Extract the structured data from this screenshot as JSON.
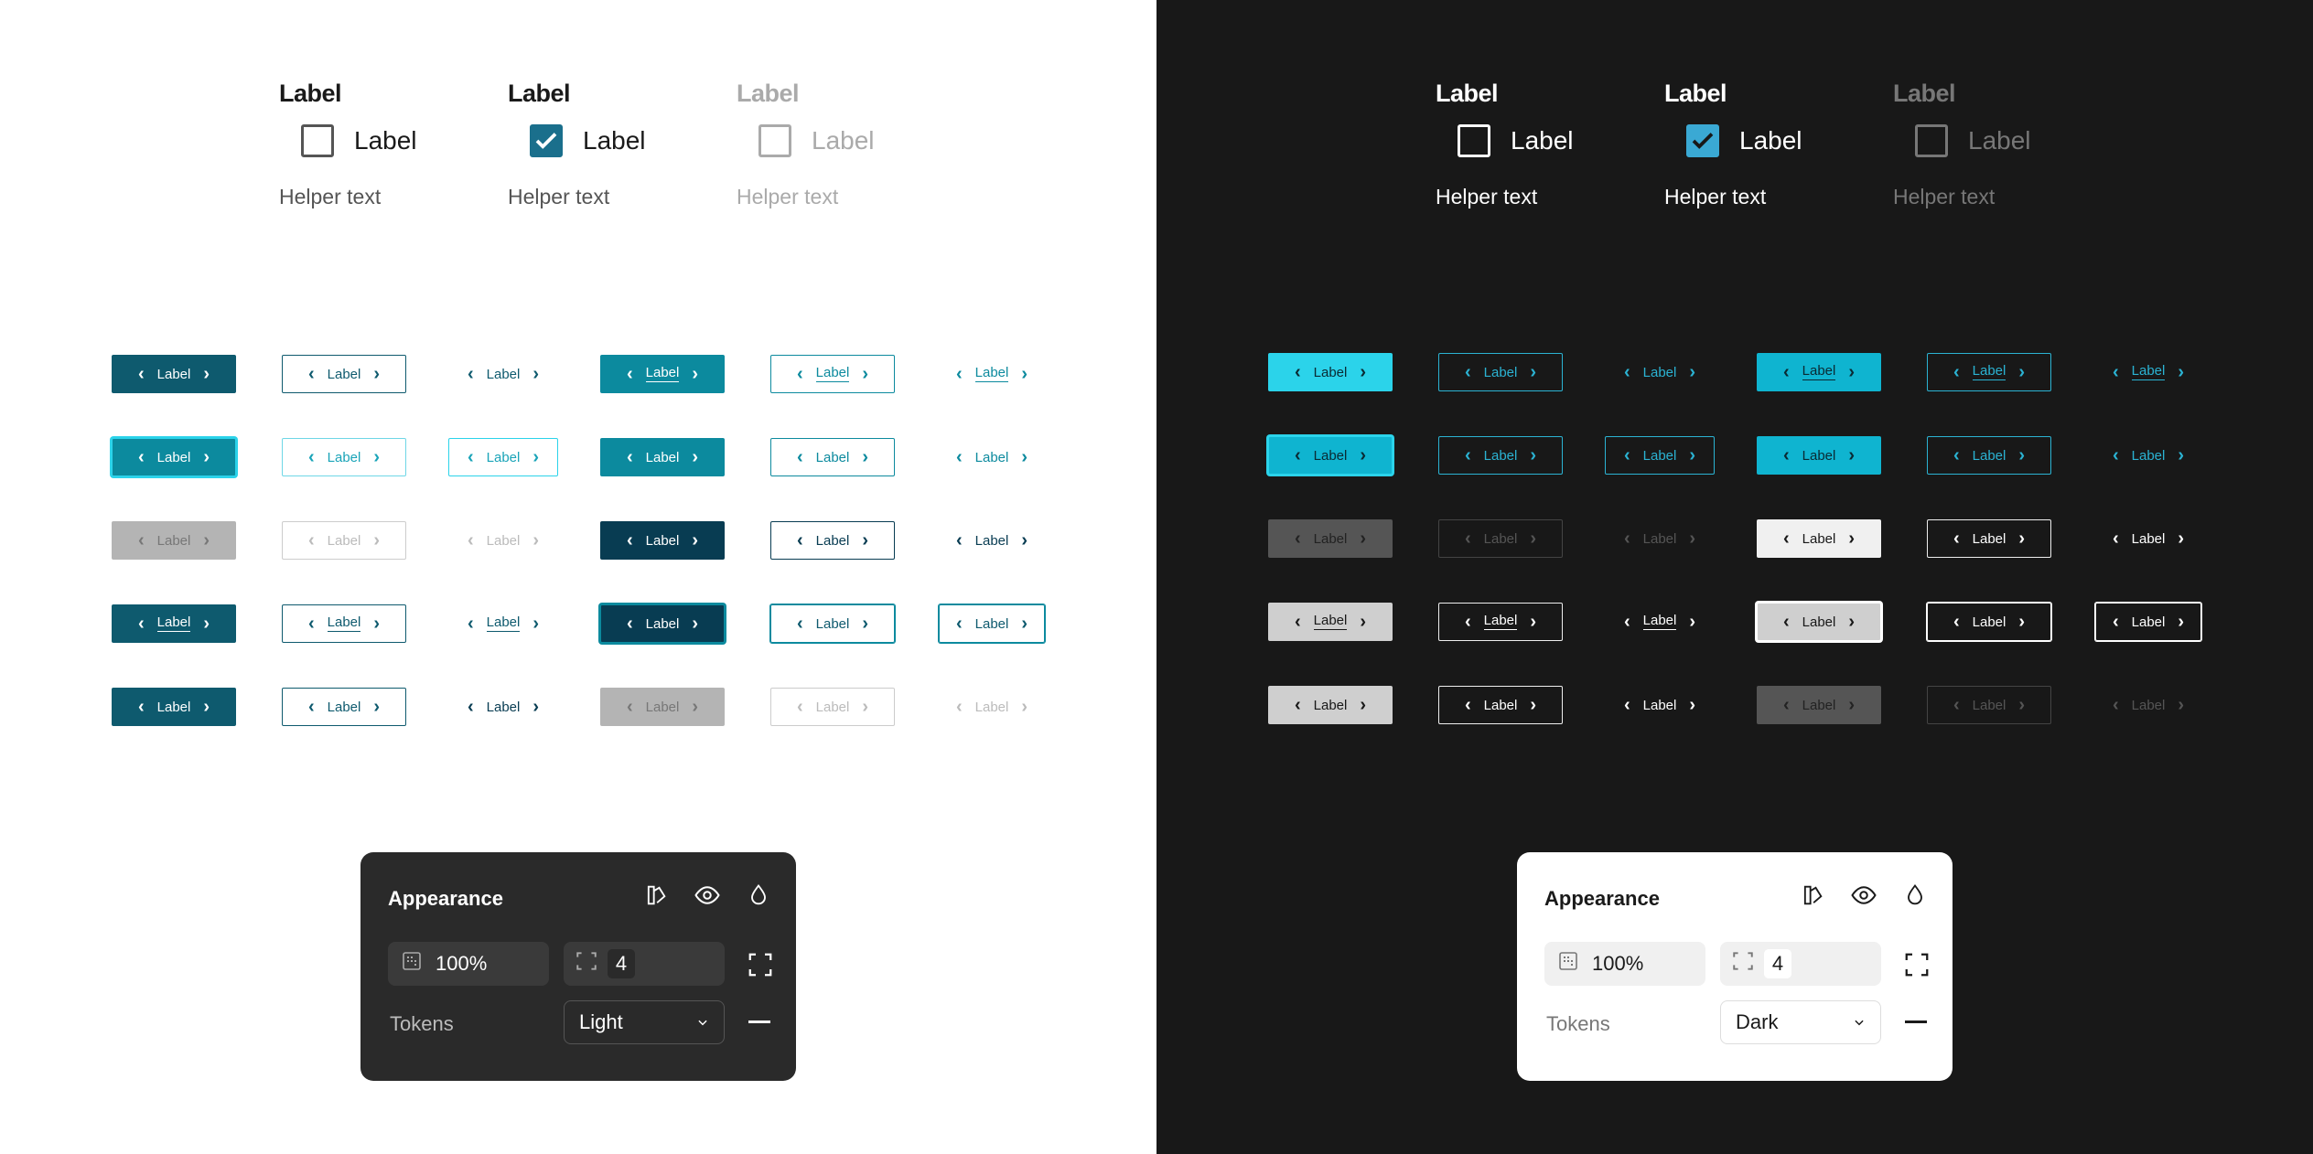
{
  "checkbox_groups": {
    "title": "Label",
    "label": "Label",
    "helper": "Helper text"
  },
  "button_label": "Label",
  "chevron_left": "‹",
  "chevron_right": "›",
  "appearance": {
    "title": "Appearance",
    "opacity": "100%",
    "radius": "4",
    "tokens_label": "Tokens"
  },
  "light_panel": {
    "token_value": "Light"
  },
  "dark_panel": {
    "token_value": "Dark"
  },
  "colors": {
    "accent_dark_teal": "#0e5a6e",
    "accent_teal": "#0c8a9e",
    "accent_cyan": "#2bd3ea",
    "accent_navy": "#083c52",
    "checkbox_blue": "#1a6f8c",
    "dark_checkbox_blue": "#3aa9d4"
  }
}
